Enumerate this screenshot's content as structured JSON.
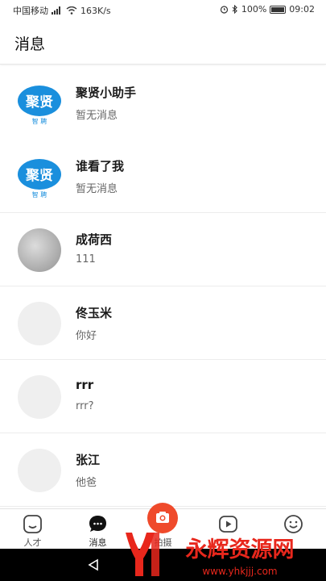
{
  "status_bar": {
    "carrier": "中国移动",
    "network_speed": "163K/s",
    "battery": "100%",
    "time": "09:02"
  },
  "header": {
    "title": "消息"
  },
  "conversations": [
    {
      "name": "聚贤小助手",
      "preview": "暂无消息",
      "avatar_text": "聚贤",
      "avatar_subtext": "智 聘"
    },
    {
      "name": "谁看了我",
      "preview": "暂无消息",
      "avatar_text": "聚贤",
      "avatar_subtext": "智 聘"
    },
    {
      "name": "成荷西",
      "preview": "111"
    },
    {
      "name": "佟玉米",
      "preview": "你好"
    },
    {
      "name": "rrr",
      "preview": "rrr?"
    },
    {
      "name": "张江",
      "preview": "他爸"
    }
  ],
  "tabs": [
    {
      "label": "人才",
      "icon": "home-icon"
    },
    {
      "label": "消息",
      "icon": "chat-bubble-icon",
      "active": true
    },
    {
      "label": "拍摄",
      "icon": "camera-icon"
    },
    {
      "label": "",
      "icon": "video-play-icon"
    },
    {
      "label": "",
      "icon": "smiley-icon"
    }
  ],
  "watermark": {
    "text": "永辉资源网",
    "url": "www.yhkjjj.com"
  },
  "colors": {
    "accent": "#ef4a2b",
    "logo_blue": "#1a8fdd",
    "watermark_red": "#e8271c",
    "header_border": "#e6e6e6"
  }
}
